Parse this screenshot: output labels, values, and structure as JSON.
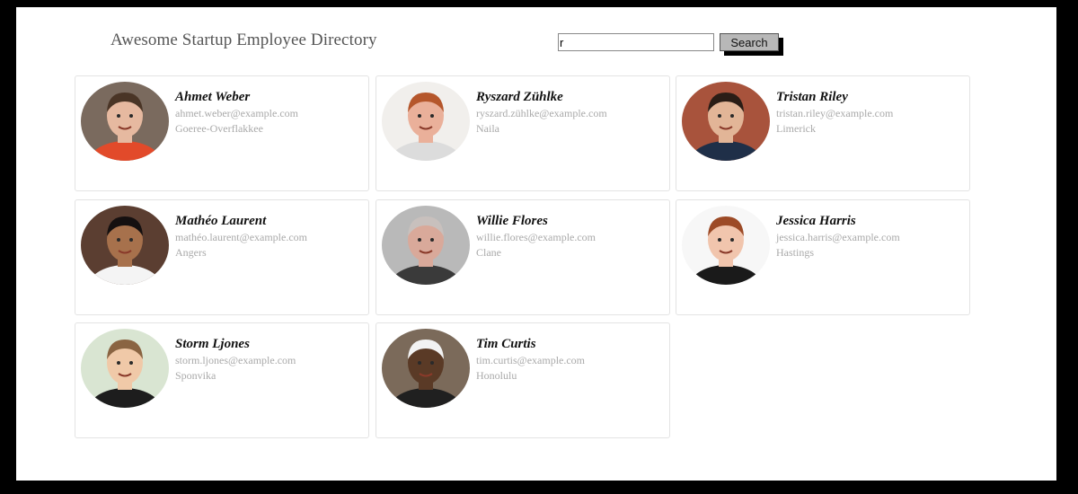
{
  "header": {
    "title": "Awesome Startup Employee Directory",
    "search_value": "r",
    "search_button": "Search"
  },
  "employees": [
    {
      "name": "Ahmet Weber",
      "email": "ahmet.weber@example.com",
      "city": "Goeree-Overflakkee",
      "bg": "#7a6a5e",
      "skin": "#e6b9a0",
      "hair": "#4a3526",
      "shirt": "#e24a2a"
    },
    {
      "name": "Ryszard Zühlke",
      "email": "ryszard.zühlke@example.com",
      "city": "Naila",
      "bg": "#f1efec",
      "skin": "#eab09a",
      "hair": "#b5562b",
      "shirt": "#dcdcdc"
    },
    {
      "name": "Tristan Riley",
      "email": "tristan.riley@example.com",
      "city": "Limerick",
      "bg": "#a8533c",
      "skin": "#e2b597",
      "hair": "#2a1d16",
      "shirt": "#1f2f48"
    },
    {
      "name": "Mathéo Laurent",
      "email": "mathéo.laurent@example.com",
      "city": "Angers",
      "bg": "#5b3e31",
      "skin": "#a7714c",
      "hair": "#151010",
      "shirt": "#f4f4f4"
    },
    {
      "name": "Willie Flores",
      "email": "willie.flores@example.com",
      "city": "Clane",
      "bg": "#b9b9b9",
      "skin": "#d9a99a",
      "hair": "#c8c0bd",
      "shirt": "#3a3a3a"
    },
    {
      "name": "Jessica Harris",
      "email": "jessica.harris@example.com",
      "city": "Hastings",
      "bg": "#f7f7f7",
      "skin": "#f1c5ad",
      "hair": "#9c4a26",
      "shirt": "#1a1a1a"
    },
    {
      "name": "Storm Ljones",
      "email": "storm.ljones@example.com",
      "city": "Sponvika",
      "bg": "#d9e5d2",
      "skin": "#f0c9a8",
      "hair": "#8a6442",
      "shirt": "#1d1d1d"
    },
    {
      "name": "Tim Curtis",
      "email": "tim.curtis@example.com",
      "city": "Honolulu",
      "bg": "#7b6a5a",
      "skin": "#5a3a26",
      "hair": "#f2f2f2",
      "shirt": "#202020"
    }
  ]
}
